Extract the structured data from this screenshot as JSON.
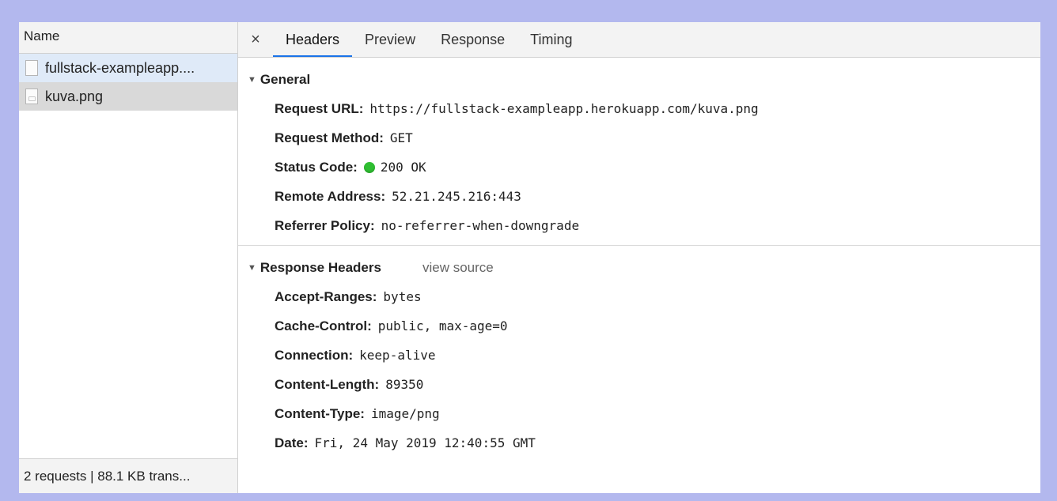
{
  "left": {
    "header": "Name",
    "requests": [
      {
        "name": "fullstack-exampleapp....",
        "icon": "document-icon"
      },
      {
        "name": "kuva.png",
        "icon": "image-file-icon"
      }
    ],
    "footer": "2 requests | 88.1 KB trans..."
  },
  "tabs": {
    "close": "×",
    "items": [
      "Headers",
      "Preview",
      "Response",
      "Timing"
    ],
    "active": "Headers"
  },
  "general": {
    "title": "General",
    "rows": [
      {
        "key": "Request URL:",
        "value": "https://fullstack-exampleapp.herokuapp.com/kuva.png"
      },
      {
        "key": "Request Method:",
        "value": "GET"
      },
      {
        "key": "Status Code:",
        "value": "200 OK",
        "status_color": "#2fbf32"
      },
      {
        "key": "Remote Address:",
        "value": "52.21.245.216:443"
      },
      {
        "key": "Referrer Policy:",
        "value": "no-referrer-when-downgrade"
      }
    ]
  },
  "response_headers": {
    "title": "Response Headers",
    "view_source": "view source",
    "rows": [
      {
        "key": "Accept-Ranges:",
        "value": "bytes"
      },
      {
        "key": "Cache-Control:",
        "value": "public, max-age=0"
      },
      {
        "key": "Connection:",
        "value": "keep-alive"
      },
      {
        "key": "Content-Length:",
        "value": "89350"
      },
      {
        "key": "Content-Type:",
        "value": "image/png"
      },
      {
        "key": "Date:",
        "value": "Fri, 24 May 2019 12:40:55 GMT"
      }
    ]
  },
  "colors": {
    "background": "#b3b8ee",
    "active_tab_underline": "#1a73e8",
    "status_ok": "#2fbf32"
  }
}
